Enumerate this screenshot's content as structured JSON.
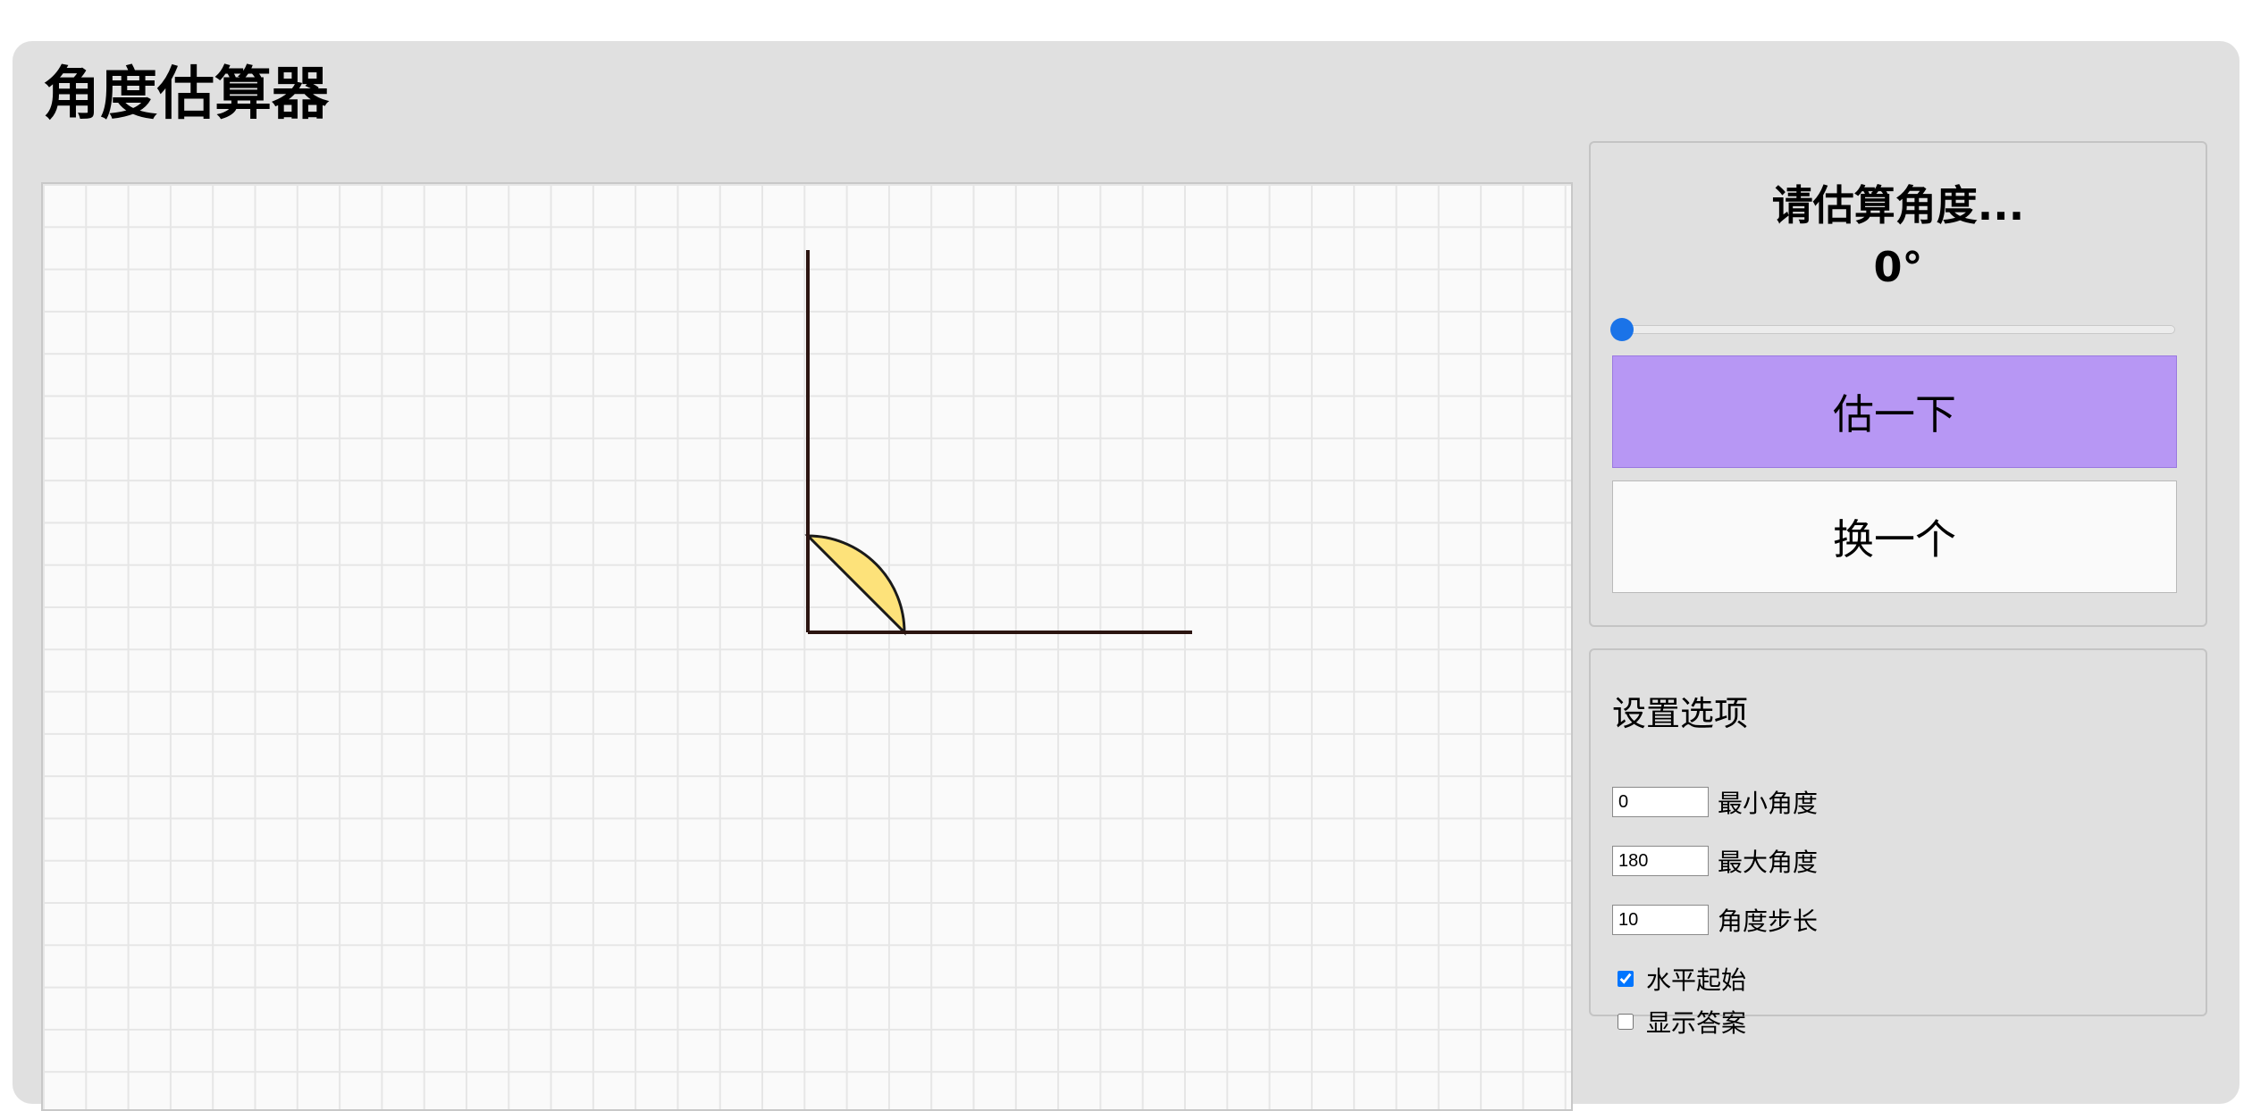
{
  "app": {
    "title": "角度估算器"
  },
  "figure": {
    "angle_degrees": 90,
    "line_color": "#2b1410",
    "arc_fill_color": "#fde27a",
    "arc_stroke_color": "#1a1a1a",
    "grid_color": "#e6e6e6",
    "background_color": "#fafafa"
  },
  "estimate": {
    "prompt": "请估算角度...",
    "value_display": "0°",
    "slider_value": 0,
    "estimate_button": "估一下",
    "new_button": "换一个",
    "accent_color": "#b797f4"
  },
  "settings": {
    "title": "设置选项",
    "fields": [
      {
        "label": "最小角度",
        "value": "0"
      },
      {
        "label": "最大角度",
        "value": "180"
      },
      {
        "label": "角度步长",
        "value": "10"
      }
    ],
    "checkboxes": [
      {
        "label": "水平起始",
        "checked": true
      },
      {
        "label": "显示答案",
        "checked": false
      }
    ]
  }
}
